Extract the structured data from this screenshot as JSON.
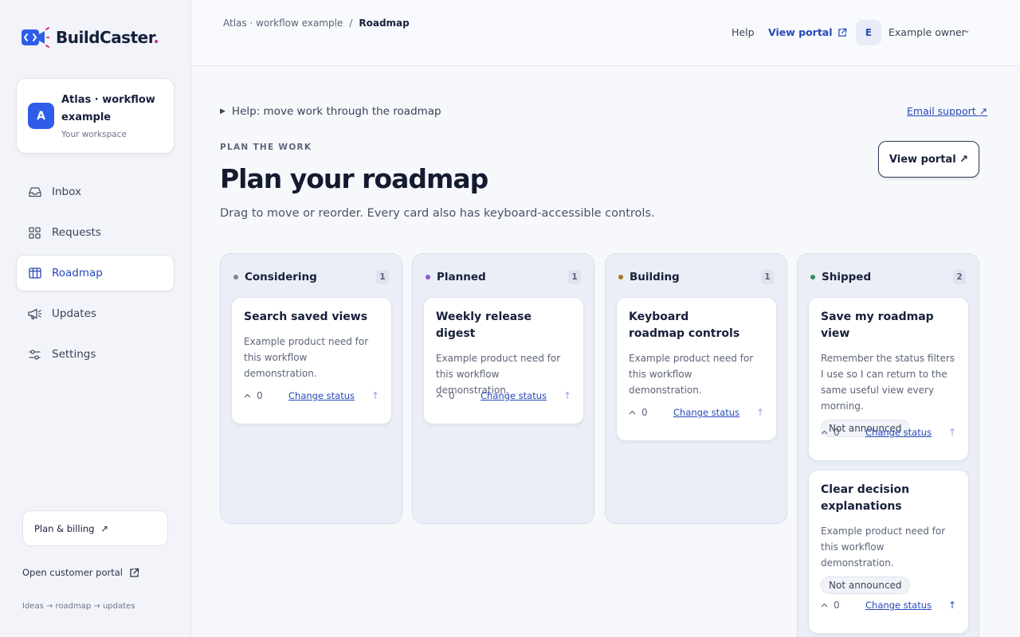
{
  "brand": {
    "name": "BuildCaster",
    "dot": ".",
    "accent": "#e0307a"
  },
  "workspace": {
    "avatar": "A",
    "name": "Atlas · workflow example",
    "subtitle": "Your workspace"
  },
  "nav": [
    {
      "label": "Inbox",
      "icon": "inbox-icon",
      "active": false
    },
    {
      "label": "Requests",
      "icon": "grid-icon",
      "active": false
    },
    {
      "label": "Roadmap",
      "icon": "roadmap-icon",
      "active": true
    },
    {
      "label": "Updates",
      "icon": "megaphone-icon",
      "active": false
    },
    {
      "label": "Settings",
      "icon": "sliders-icon",
      "active": false
    }
  ],
  "sidebar_footer": {
    "billing": "Plan & billing",
    "billing_arrow": "↗",
    "portal": "Open customer portal",
    "tagline": "Ideas → roadmap → updates"
  },
  "topbar": {
    "crumbs": [
      "Atlas · workflow example",
      "/",
      "Roadmap"
    ],
    "help": "Help",
    "view_portal": "View portal",
    "avatar": "E",
    "owner": "Example owner",
    "chevron": "⌄"
  },
  "page": {
    "help_toggle": "Help: move work through the roadmap",
    "help_caret": "▶",
    "email_support": "Email support ↗",
    "eyebrow": "PLAN THE WORK",
    "title": "Plan your roadmap",
    "subtitle": "Drag to move or reorder. Every card also has keyboard-accessible controls.",
    "view_portal_button": "View portal ↗"
  },
  "columns": [
    {
      "name": "Considering",
      "count": "1",
      "dot_color": "#7d8699",
      "cards": [
        {
          "title": "Search saved views",
          "desc": "Example product need for this workflow demonstration.",
          "badge": "",
          "votes": "0",
          "change": "Change status",
          "up": "↑",
          "vote_icon": "^"
        }
      ]
    },
    {
      "name": "Planned",
      "count": "1",
      "dot_color": "#8b55d6",
      "cards": [
        {
          "title": "Weekly release digest",
          "desc": "Example product need for this workflow demonstration.",
          "badge": "",
          "votes": "0",
          "change": "Change status",
          "up": "↑",
          "vote_icon": "^"
        }
      ]
    },
    {
      "name": "Building",
      "count": "1",
      "dot_color": "#a9782a",
      "cards": [
        {
          "title": "Keyboard roadmap controls",
          "desc": "Example product need for this workflow demonstration.",
          "badge": "",
          "votes": "0",
          "change": "Change status",
          "up": "↑",
          "vote_icon": "^"
        }
      ]
    },
    {
      "name": "Shipped",
      "count": "2",
      "dot_color": "#2f8f5a",
      "cards": [
        {
          "title": "Save my roadmap view",
          "desc": "Remember the status filters I use so I can return to the same useful view every morning.",
          "badge": "Not announced",
          "votes": "0",
          "change": "Change status",
          "up": "↑",
          "vote_icon": "^"
        },
        {
          "title": "Clear decision explanations",
          "desc": "Example product need for this workflow demonstration.",
          "badge": "Not announced",
          "votes": "0",
          "change": "Change status",
          "up": "↑",
          "vote_icon": "^"
        }
      ]
    }
  ]
}
